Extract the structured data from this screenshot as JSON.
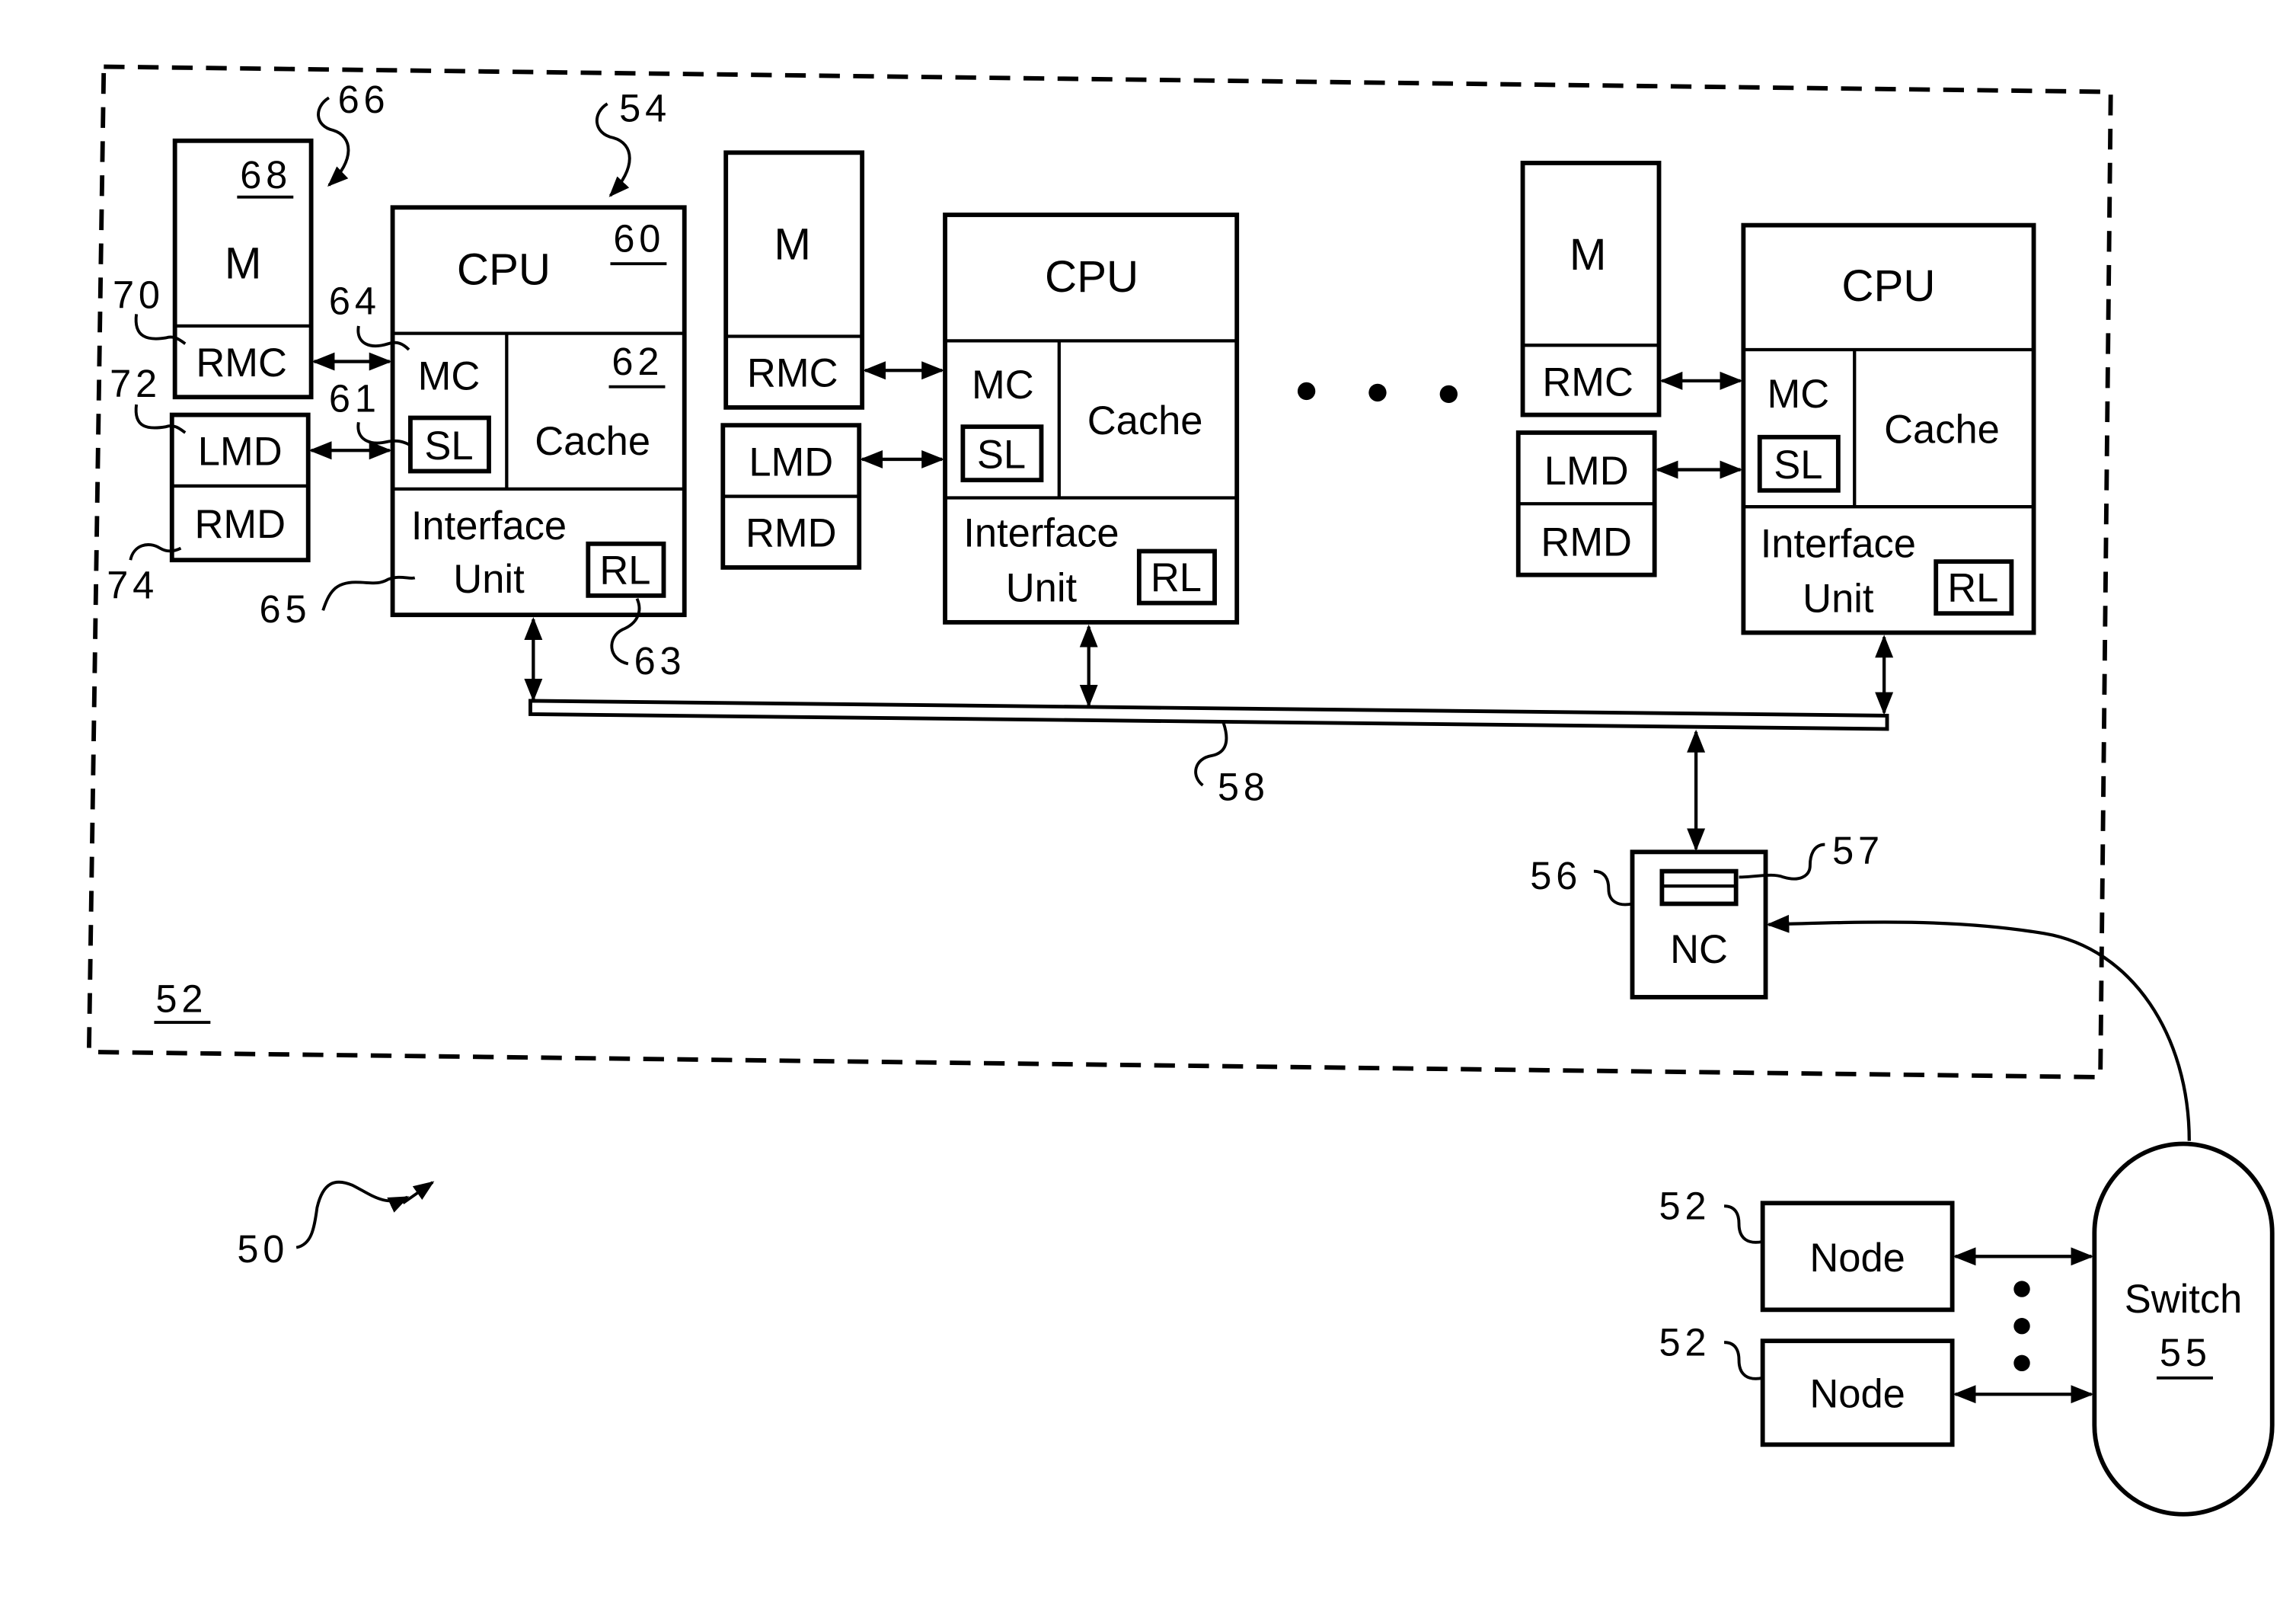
{
  "figure": {
    "system_ref": "50",
    "node_ref": "52"
  },
  "groups": [
    {
      "memory": {
        "label": "M",
        "ref": "68",
        "rmc": "RMC",
        "lmd": "LMD",
        "rmd": "RMD"
      },
      "cpu": {
        "label": "CPU",
        "ref": "60",
        "mc": "MC",
        "sl": "SL",
        "cache": "Cache",
        "cache_ref": "62",
        "iface_line1": "Interface",
        "iface_line2": "Unit",
        "rl": "RL"
      }
    },
    {
      "memory": {
        "label": "M",
        "rmc": "RMC",
        "lmd": "LMD",
        "rmd": "RMD"
      },
      "cpu": {
        "label": "CPU",
        "mc": "MC",
        "sl": "SL",
        "cache": "Cache",
        "iface_line1": "Interface",
        "iface_line2": "Unit",
        "rl": "RL"
      }
    },
    {
      "memory": {
        "label": "M",
        "rmc": "RMC",
        "lmd": "LMD",
        "rmd": "RMD"
      },
      "cpu": {
        "label": "CPU",
        "mc": "MC",
        "sl": "SL",
        "cache": "Cache",
        "iface_line1": "Interface",
        "iface_line2": "Unit",
        "rl": "RL"
      }
    }
  ],
  "refs": {
    "memory_unit": "66",
    "processor": "54",
    "rmc": "70",
    "lmd": "72",
    "rmd": "74",
    "mc": "64",
    "sl": "61",
    "iface": "65",
    "rl": "63",
    "bus": "58",
    "nc": "56",
    "nc_buffer": "57"
  },
  "nc": {
    "label": "NC"
  },
  "external": {
    "nodes": [
      {
        "label": "Node",
        "ref": "52"
      },
      {
        "label": "Node",
        "ref": "52"
      }
    ],
    "switch": {
      "label": "Switch",
      "ref": "55"
    }
  }
}
